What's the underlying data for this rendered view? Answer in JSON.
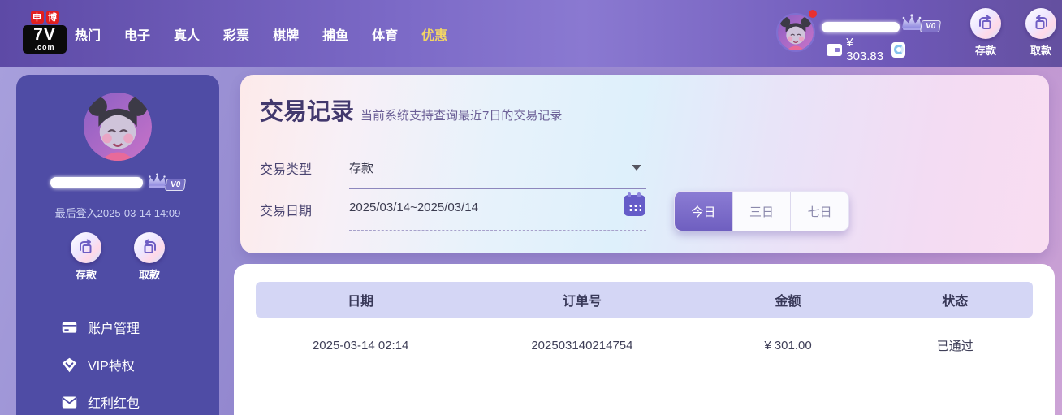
{
  "colors": {
    "accent-gold": "#f2d565",
    "sidebar-bg": "#4f4ca5",
    "table-head-bg": "#d4d6f5",
    "active-tab": "#7b68c8"
  },
  "topbar": {
    "logo": {
      "badge1": "申",
      "badge2": "博",
      "brand": "7V",
      "domain": ".com"
    },
    "nav": [
      {
        "label": "热门"
      },
      {
        "label": "电子"
      },
      {
        "label": "真人"
      },
      {
        "label": "彩票"
      },
      {
        "label": "棋牌"
      },
      {
        "label": "捕鱼"
      },
      {
        "label": "体育"
      },
      {
        "label": "优惠"
      }
    ],
    "user": {
      "vip_badge": "V0",
      "balance": "¥ 303.83"
    },
    "actions": {
      "deposit": "存款",
      "withdraw": "取款"
    }
  },
  "sidebar": {
    "vip_badge": "V0",
    "last_login": "最后登入2025-03-14 14:09",
    "actions": {
      "deposit": "存款",
      "withdraw": "取款"
    },
    "menu": [
      {
        "label": "账户管理"
      },
      {
        "label": "VIP特权"
      },
      {
        "label": "红利红包"
      }
    ]
  },
  "main": {
    "title": "交易记录",
    "subtitle": "当前系统支持查询最近7日的交易记录",
    "filters": {
      "type_label": "交易类型",
      "type_value": "存款",
      "date_label": "交易日期",
      "date_value": "2025/03/14~2025/03/14"
    },
    "range_tabs": [
      {
        "label": "今日",
        "active": true
      },
      {
        "label": "三日",
        "active": false
      },
      {
        "label": "七日",
        "active": false
      }
    ],
    "table": {
      "columns": [
        "日期",
        "订单号",
        "金额",
        "状态"
      ],
      "rows": [
        {
          "date": "2025-03-14 02:14",
          "order_no": "202503140214754",
          "amount": "¥ 301.00",
          "status": "已通过"
        }
      ]
    }
  }
}
